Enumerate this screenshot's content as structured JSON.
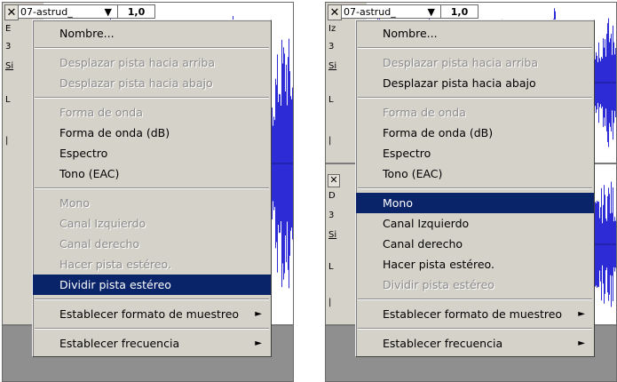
{
  "left": {
    "track": {
      "name": "07-astrud_",
      "rate": "1,0"
    },
    "track_labels": {
      "row1": "E",
      "row2": "3",
      "row3": "Si",
      "row4": "L",
      "row5": "|"
    },
    "menu": {
      "items": [
        {
          "label": "Nombre...",
          "enabled": true
        },
        {
          "label": "Desplazar pista hacia arriba",
          "enabled": false
        },
        {
          "label": "Desplazar pista hacia abajo",
          "enabled": false
        },
        {
          "label": "Forma de onda",
          "enabled": false
        },
        {
          "label": "Forma de onda (dB)",
          "enabled": true
        },
        {
          "label": "Espectro",
          "enabled": true
        },
        {
          "label": "Tono (EAC)",
          "enabled": true
        },
        {
          "label": "Mono",
          "enabled": false
        },
        {
          "label": "Canal Izquierdo",
          "enabled": false
        },
        {
          "label": "Canal derecho",
          "enabled": false
        },
        {
          "label": "Hacer pista estéreo.",
          "enabled": false
        },
        {
          "label": "Dividir pista estéreo",
          "enabled": true,
          "selected": true
        },
        {
          "label": "Establecer formato de muestreo",
          "enabled": true,
          "submenu": true
        },
        {
          "label": "Establecer frecuencia",
          "enabled": true,
          "submenu": true
        }
      ]
    }
  },
  "right": {
    "track": {
      "name": "07-astrud_",
      "rate": "1,0"
    },
    "track_labels": {
      "row1": "Iz",
      "row2": "3",
      "row3": "Si",
      "row4": "L",
      "row5": "|"
    },
    "second_track_labels": {
      "row1": "D",
      "row2": "3",
      "row3": "Si",
      "row4": "L",
      "row5": "|"
    },
    "menu": {
      "items": [
        {
          "label": "Nombre...",
          "enabled": true
        },
        {
          "label": "Desplazar pista hacia arriba",
          "enabled": false
        },
        {
          "label": "Desplazar pista hacia abajo",
          "enabled": true
        },
        {
          "label": "Forma de onda",
          "enabled": false
        },
        {
          "label": "Forma de onda (dB)",
          "enabled": true
        },
        {
          "label": "Espectro",
          "enabled": true
        },
        {
          "label": "Tono (EAC)",
          "enabled": true
        },
        {
          "label": "Mono",
          "enabled": true,
          "selected": true
        },
        {
          "label": "Canal Izquierdo",
          "enabled": true
        },
        {
          "label": "Canal derecho",
          "enabled": true
        },
        {
          "label": "Hacer pista estéreo.",
          "enabled": true
        },
        {
          "label": "Dividir pista estéreo",
          "enabled": false
        },
        {
          "label": "Establecer formato de muestreo",
          "enabled": true,
          "submenu": true
        },
        {
          "label": "Establecer frecuencia",
          "enabled": true,
          "submenu": true
        }
      ]
    }
  },
  "icons": {
    "close": "✕",
    "dropdown": "▼",
    "submenu": "►"
  },
  "colors": {
    "wave": "#2d2bd6",
    "selection": "#0a246a",
    "menu_bg": "#d5d2ca",
    "disabled_text": "#8c8c8c"
  }
}
